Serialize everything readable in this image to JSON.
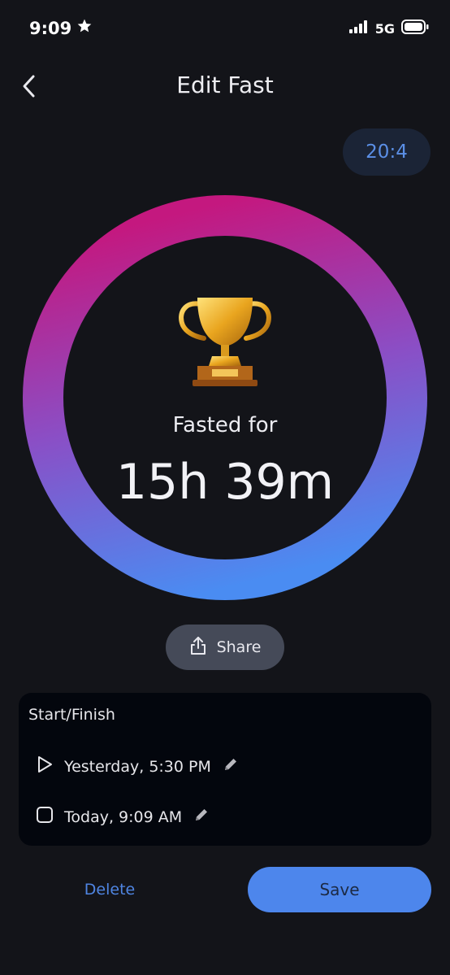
{
  "status_bar": {
    "time": "9:09",
    "network": "5G"
  },
  "header": {
    "title": "Edit Fast"
  },
  "plan": {
    "label": "20:4"
  },
  "summary": {
    "label": "Fasted for",
    "duration": "15h 39m"
  },
  "share": {
    "label": "Share"
  },
  "start_finish": {
    "title": "Start/Finish",
    "start": "Yesterday, 5:30 PM",
    "finish": "Today, 9:09 AM"
  },
  "actions": {
    "delete": "Delete",
    "save": "Save"
  },
  "colors": {
    "ring_start": "#c4187f",
    "ring_end": "#4a8cf2",
    "accent": "#4d86ec",
    "background": "#131419"
  },
  "icons": {
    "status": [
      "star-icon",
      "signal-icon",
      "battery-icon"
    ],
    "back": "chevron-left-icon",
    "trophy": "trophy-icon",
    "share": "share-icon",
    "start": "play-icon",
    "finish": "stop-icon",
    "edit": "pencil-icon"
  }
}
